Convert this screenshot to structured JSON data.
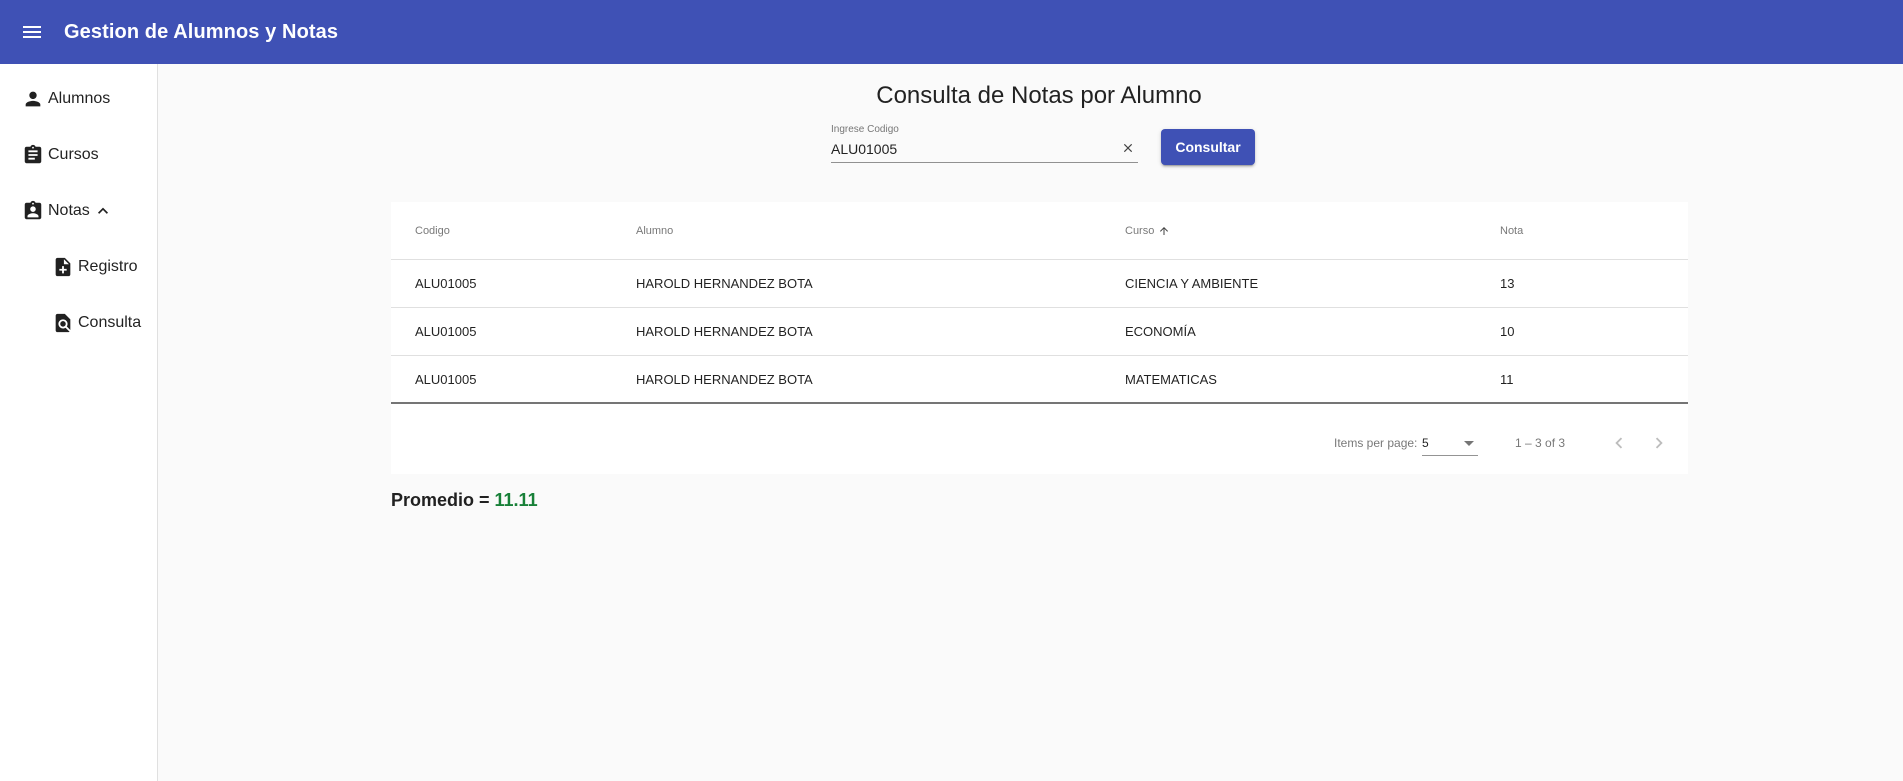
{
  "app": {
    "title": "Gestion de Alumnos y Notas"
  },
  "icons": {
    "menu": "menu-icon",
    "person": "person-icon",
    "clipboard": "assignment-icon",
    "notas": "assignment-ind-icon",
    "registro": "note-add-icon",
    "consulta": "find-in-page-icon",
    "chevron": "expand-less-icon"
  },
  "sidebar": {
    "items": [
      {
        "label": "Alumnos"
      },
      {
        "label": "Cursos"
      },
      {
        "label": "Notas"
      },
      {
        "label": "Registro"
      },
      {
        "label": "Consulta"
      }
    ]
  },
  "page": {
    "title": "Consulta de Notas por Alumno"
  },
  "search": {
    "label": "Ingrese Codigo",
    "value": "ALU01005",
    "button_label": "Consultar"
  },
  "table": {
    "headers": [
      "Codigo",
      "Alumno",
      "Curso",
      "Nota"
    ],
    "sorted_column": "Curso",
    "rows": [
      [
        "ALU01005",
        "HAROLD HERNANDEZ BOTA",
        "CIENCIA Y AMBIENTE",
        "13"
      ],
      [
        "ALU01005",
        "HAROLD HERNANDEZ BOTA",
        "ECONOMÍA",
        "10"
      ],
      [
        "ALU01005",
        "HAROLD HERNANDEZ BOTA",
        "MATEMATICAS",
        "11"
      ]
    ]
  },
  "paginator": {
    "items_label": "Items per page:",
    "page_size": "5",
    "range": "1 – 3 of 3"
  },
  "summary": {
    "label": "Promedio = ",
    "value": "11.11"
  },
  "colors": {
    "primary": "#3f51b5",
    "average": "#188038"
  }
}
